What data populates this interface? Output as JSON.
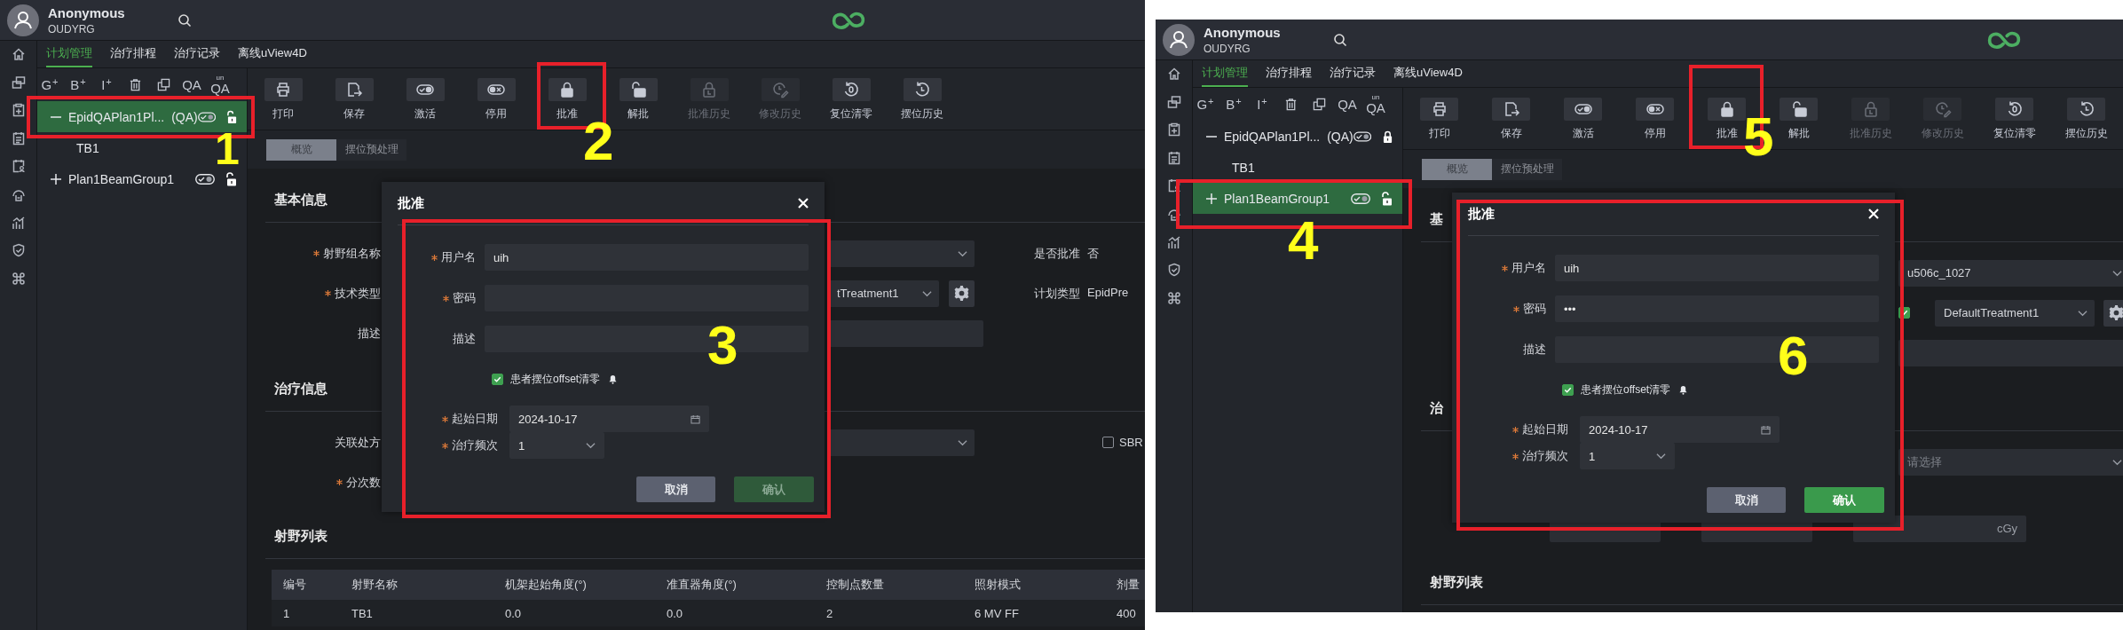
{
  "panels": [
    {
      "user": {
        "name": "Anonymous",
        "code": "OUDYRG"
      },
      "nav_tabs": [
        {
          "label": "计划管理",
          "selected": true
        },
        {
          "label": "治疗排程",
          "selected": false
        },
        {
          "label": "治疗记录",
          "selected": false
        },
        {
          "label": "离线uView4D",
          "selected": false
        }
      ],
      "tree_tools": [
        {
          "kind": "add",
          "label": "G",
          "mark": "+"
        },
        {
          "kind": "add",
          "label": "B",
          "mark": "+"
        },
        {
          "kind": "add",
          "label": "I",
          "mark": "+"
        },
        {
          "kind": "delete"
        },
        {
          "kind": "copy"
        },
        {
          "kind": "text",
          "label": "QA"
        },
        {
          "kind": "stacked",
          "label": "QA",
          "over": "un"
        }
      ],
      "tree": [
        {
          "label": "EpidQAPlan1Pl...",
          "tag": "(QA)",
          "expanded": true,
          "selected": true,
          "active": true,
          "locked": false,
          "callout": "1",
          "children": [
            {
              "label": "TB1",
              "selected": false
            }
          ]
        },
        {
          "label": "Plan1BeamGroup1",
          "expanded": false,
          "selected": false,
          "active": true,
          "locked": false
        }
      ],
      "toolbar": [
        {
          "kind": "print",
          "label": "打印",
          "disabled": false
        },
        {
          "kind": "save",
          "label": "保存",
          "disabled": false
        },
        {
          "kind": "activate",
          "label": "激活",
          "disabled": false
        },
        {
          "kind": "deactivate",
          "label": "停用",
          "disabled": false
        },
        {
          "kind": "approve",
          "label": "批准",
          "disabled": false,
          "callout": "2"
        },
        {
          "kind": "unapprove",
          "label": "解批",
          "disabled": false
        },
        {
          "kind": "approve-history",
          "label": "批准历史",
          "disabled": true
        },
        {
          "kind": "edit-history",
          "label": "修改历史",
          "disabled": true
        },
        {
          "kind": "reset",
          "label": "复位清零",
          "disabled": false
        },
        {
          "kind": "history",
          "label": "摆位历史",
          "disabled": false
        }
      ],
      "sub_tabs": [
        {
          "label": "概览",
          "selected": true
        },
        {
          "label": "摆位预处理",
          "selected": false
        }
      ],
      "sections": [
        {
          "title": "基本信息",
          "rows": [
            {
              "kind": "field",
              "label": "射野组名称",
              "required": true,
              "items": [
                {
                  "kind": "select"
                },
                {
                  "kind": "info",
                  "label": "是否批准",
                  "value": "否"
                }
              ]
            },
            {
              "kind": "field",
              "label": "技术类型",
              "required": true,
              "items": [
                {
                  "kind": "select",
                  "value": "tTreatment1"
                },
                {
                  "kind": "gear"
                },
                {
                  "kind": "info",
                  "label": "计划类型",
                  "value": "EpidPre"
                }
              ]
            },
            {
              "kind": "field",
              "label": "描述",
              "required": false,
              "items": [
                {
                  "kind": "input"
                }
              ]
            }
          ]
        },
        {
          "title": "治疗信息",
          "rows": [
            {
              "kind": "field",
              "label": "关联处方",
              "required": false,
              "items": [
                {
                  "kind": "select"
                },
                {
                  "kind": "checkbox",
                  "label": "SBR",
                  "checked": false
                }
              ]
            },
            {
              "kind": "field",
              "label": "分次数",
              "required": true
            }
          ]
        },
        {
          "title": "射野列表",
          "table": {
            "columns": [
              "编号",
              "射野名称",
              "机架起始角度(°)",
              "准直器角度(°)",
              "控制点数量",
              "照射模式",
              "剂量"
            ],
            "rows": [
              [
                "1",
                "TB1",
                "0.0",
                "0.0",
                "2",
                "6 MV FF",
                "400"
              ]
            ]
          }
        }
      ],
      "dialog": {
        "title": "批准",
        "callout": {
          "number": "3",
          "kind": "body"
        },
        "fields": [
          {
            "label": "用户名",
            "required": true,
            "value": "uih"
          },
          {
            "label": "密码",
            "required": true
          },
          {
            "label": "描述",
            "required": false
          }
        ],
        "checkbox": {
          "label": "患者摆位offset清零",
          "checked": true
        },
        "date": {
          "label": "起始日期",
          "required": true,
          "value": "2024-10-17"
        },
        "frequency": {
          "label": "治疗频次",
          "required": true,
          "value": "1"
        },
        "buttons": [
          {
            "kind": "cancel",
            "label": "取消",
            "disabled": false
          },
          {
            "kind": "confirm",
            "label": "确认",
            "disabled": true
          }
        ]
      }
    },
    {
      "user": {
        "name": "Anonymous",
        "code": "OUDYRG"
      },
      "nav_tabs": [
        {
          "label": "计划管理",
          "selected": true
        },
        {
          "label": "治疗排程",
          "selected": false
        },
        {
          "label": "治疗记录",
          "selected": false
        },
        {
          "label": "离线uView4D",
          "selected": false
        }
      ],
      "tree_tools": [
        {
          "kind": "add",
          "label": "G",
          "mark": "+"
        },
        {
          "kind": "add",
          "label": "B",
          "mark": "+"
        },
        {
          "kind": "add",
          "label": "I",
          "mark": "+"
        },
        {
          "kind": "delete"
        },
        {
          "kind": "copy"
        },
        {
          "kind": "text",
          "label": "QA"
        },
        {
          "kind": "stacked",
          "label": "QA",
          "over": "un"
        }
      ],
      "tree": [
        {
          "label": "EpidQAPlan1Pl...",
          "tag": "(QA)",
          "expanded": true,
          "selected": false,
          "active": true,
          "locked": true,
          "children": [
            {
              "label": "TB1",
              "selected": false
            }
          ]
        },
        {
          "label": "Plan1BeamGroup1",
          "expanded": false,
          "selected": true,
          "active": true,
          "locked": false,
          "callout": "4"
        }
      ],
      "toolbar": [
        {
          "kind": "print",
          "label": "打印",
          "disabled": false
        },
        {
          "kind": "save",
          "label": "保存",
          "disabled": false
        },
        {
          "kind": "activate",
          "label": "激活",
          "disabled": false
        },
        {
          "kind": "deactivate",
          "label": "停用",
          "disabled": false
        },
        {
          "kind": "approve",
          "label": "批准",
          "disabled": false,
          "callout": "5"
        },
        {
          "kind": "unapprove",
          "label": "解批",
          "disabled": false
        },
        {
          "kind": "approve-history",
          "label": "批准历史",
          "disabled": true
        },
        {
          "kind": "edit-history",
          "label": "修改历史",
          "disabled": true
        },
        {
          "kind": "reset",
          "label": "复位清零",
          "disabled": false
        },
        {
          "kind": "history",
          "label": "摆位历史",
          "disabled": false
        }
      ],
      "sub_tabs": [
        {
          "label": "概览",
          "selected": true
        },
        {
          "label": "摆位预处理",
          "selected": false
        }
      ],
      "sections": [
        {
          "title": "基",
          "rows": [
            {
              "kind": "field",
              "items": [
                {
                  "kind": "select",
                  "value": "u506c_1027"
                }
              ]
            },
            {
              "kind": "field",
              "items": [
                {
                  "kind": "checkbox",
                  "checked": true
                },
                {
                  "kind": "select",
                  "value": "DefaultTreatment1"
                },
                {
                  "kind": "gear"
                }
              ]
            },
            {
              "kind": "field",
              "items": [
                {
                  "kind": "input"
                }
              ]
            }
          ]
        },
        {
          "title": "治",
          "rows": [
            {
              "kind": "field",
              "items": [
                {
                  "kind": "select",
                  "placeholder": "请选择"
                }
              ]
            },
            {
              "kind": "dose",
              "items": [
                {
                  "kind": "input"
                },
                {
                  "kind": "input"
                },
                {
                  "kind": "input",
                  "unit": "cGy"
                }
              ]
            }
          ]
        },
        {
          "title": "射野列表"
        }
      ],
      "dialog": {
        "title": "批准",
        "callout": {
          "number": "6",
          "kind": "dialog"
        },
        "fields": [
          {
            "label": "用户名",
            "required": true,
            "value": "uih"
          },
          {
            "label": "密码",
            "required": true,
            "value": "•••"
          },
          {
            "label": "描述",
            "required": false
          }
        ],
        "checkbox": {
          "label": "患者摆位offset清零",
          "checked": true
        },
        "date": {
          "label": "起始日期",
          "required": true,
          "value": "2024-10-17"
        },
        "frequency": {
          "label": "治疗频次",
          "required": true,
          "value": "1"
        },
        "buttons": [
          {
            "kind": "cancel",
            "label": "取消",
            "disabled": false
          },
          {
            "kind": "confirm",
            "label": "确认",
            "disabled": false
          }
        ]
      }
    }
  ]
}
